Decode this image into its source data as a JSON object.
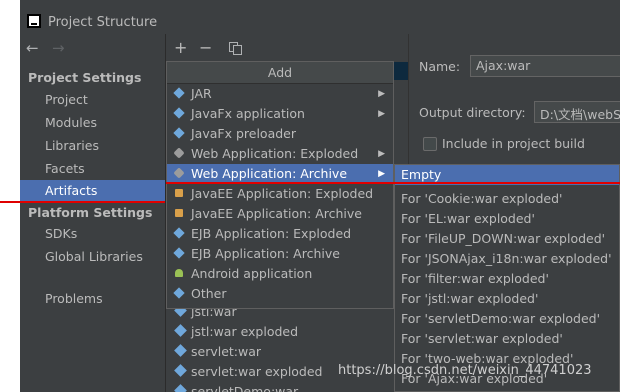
{
  "window": {
    "title": "Project Structure",
    "app_icon": "intellij-icon"
  },
  "sidebar": {
    "project_settings_header": "Project Settings",
    "project_items": [
      "Project",
      "Modules",
      "Libraries",
      "Facets",
      "Artifacts"
    ],
    "platform_settings_header": "Platform Settings",
    "platform_items": [
      "SDKs",
      "Global Libraries"
    ],
    "problems": "Problems",
    "selected": "Artifacts"
  },
  "toolbar": {
    "add": "+",
    "remove": "−",
    "copy_icon": "copy-icon"
  },
  "artifacts": [
    "jstl:war",
    "jstl:war exploded",
    "servlet:war",
    "servlet:war exploded",
    "servletDemo:war"
  ],
  "details": {
    "name_label": "Name:",
    "name_value": "Ajax:war",
    "output_label": "Output directory:",
    "output_value": "D:\\文档\\webStu",
    "include_label": "Include in project build"
  },
  "add_popup": {
    "header": "Add",
    "items": [
      {
        "label": "JAR",
        "submenu": true,
        "icon": "jar-icon"
      },
      {
        "label": "JavaFx application",
        "submenu": true,
        "icon": "javafx-icon"
      },
      {
        "label": "JavaFx preloader",
        "submenu": false,
        "icon": "javafx-icon"
      },
      {
        "label": "Web Application: Exploded",
        "submenu": true,
        "icon": "web-gear-icon"
      },
      {
        "label": "Web Application: Archive",
        "submenu": true,
        "icon": "web-archive-icon"
      },
      {
        "label": "JavaEE Application: Exploded",
        "submenu": false,
        "icon": "javaee-icon"
      },
      {
        "label": "JavaEE Application: Archive",
        "submenu": false,
        "icon": "javaee-icon"
      },
      {
        "label": "EJB Application: Exploded",
        "submenu": false,
        "icon": "ejb-icon"
      },
      {
        "label": "EJB Application: Archive",
        "submenu": false,
        "icon": "ejb-icon"
      },
      {
        "label": "Android application",
        "submenu": false,
        "icon": "android-icon"
      },
      {
        "label": "Other",
        "submenu": false,
        "icon": "other-icon"
      }
    ],
    "hovered": "Web Application: Archive"
  },
  "archive_submenu": {
    "items": [
      "Empty",
      "For 'Cookie:war exploded'",
      "For 'EL:war exploded'",
      "For 'FileUP_DOWN:war exploded'",
      "For 'JSONAjax_i18n:war exploded'",
      "For 'filter:war exploded'",
      "For 'jstl:war exploded'",
      "For 'servletDemo:war exploded'",
      "For 'servlet:war exploded'",
      "For 'two-web:war exploded'",
      "For 'Ajax:war exploded'"
    ],
    "hovered": "Empty"
  },
  "watermark": "https://blog.csdn.net/weixin_44741023",
  "colors": {
    "selection": "#4b6eaf",
    "background": "#3c3f41",
    "annotation": "#e00000"
  }
}
